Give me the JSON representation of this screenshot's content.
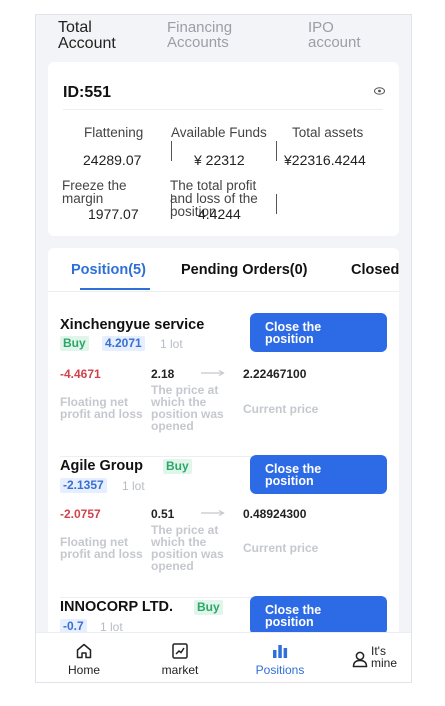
{
  "account_tabs": [
    {
      "label": "Total Account",
      "active": true
    },
    {
      "label": "Financing Accounts",
      "active": false
    },
    {
      "label": "IPO account",
      "active": false
    }
  ],
  "account": {
    "id_text": "ID:551",
    "stats": [
      {
        "label": "Flattening",
        "value": "24289.07"
      },
      {
        "label": "Available Funds",
        "value": "¥ 22312"
      },
      {
        "label": "Total assets",
        "value": "¥22316.4244"
      },
      {
        "label": "Freeze the margin",
        "value": "1977.07"
      },
      {
        "label": "The total profit and loss of the position",
        "value": "4.4244"
      }
    ]
  },
  "position_tabs": [
    {
      "label": "Position(5)",
      "active": true
    },
    {
      "label": "Pending Orders(0)",
      "active": false
    },
    {
      "label": "Closed",
      "active": false
    }
  ],
  "labels": {
    "floating": "Floating net profit and loss",
    "open_price": "The price at which the position was opened",
    "current_price": "Current price",
    "close_button": "Close the position",
    "lot": "1 lot"
  },
  "positions": [
    {
      "name": "Xinchengyue service",
      "side": "Buy",
      "change": "4.2071",
      "pnl": "-4.4671",
      "open_price": "2.18",
      "current_price": "2.22467100"
    },
    {
      "name": "Agile Group",
      "side": "Buy",
      "change": "-2.1357",
      "pnl": "-2.0757",
      "open_price": "0.51",
      "current_price": "0.48924300"
    },
    {
      "name": "INNOCORP LTD.",
      "side": "Buy",
      "change": "-0.7",
      "pnl": "",
      "open_price": "",
      "current_price": ""
    }
  ],
  "nav": [
    {
      "label": "Home",
      "icon": "home-icon",
      "active": false
    },
    {
      "label": "market",
      "icon": "chart-icon",
      "active": false
    },
    {
      "label": "Positions",
      "icon": "bars-icon",
      "active": true
    },
    {
      "label": "It's mine",
      "icon": "user-icon",
      "active": false
    }
  ],
  "colors": {
    "accent": "#2d6be6",
    "loss": "#d0434d",
    "buy": "#2aa769"
  }
}
